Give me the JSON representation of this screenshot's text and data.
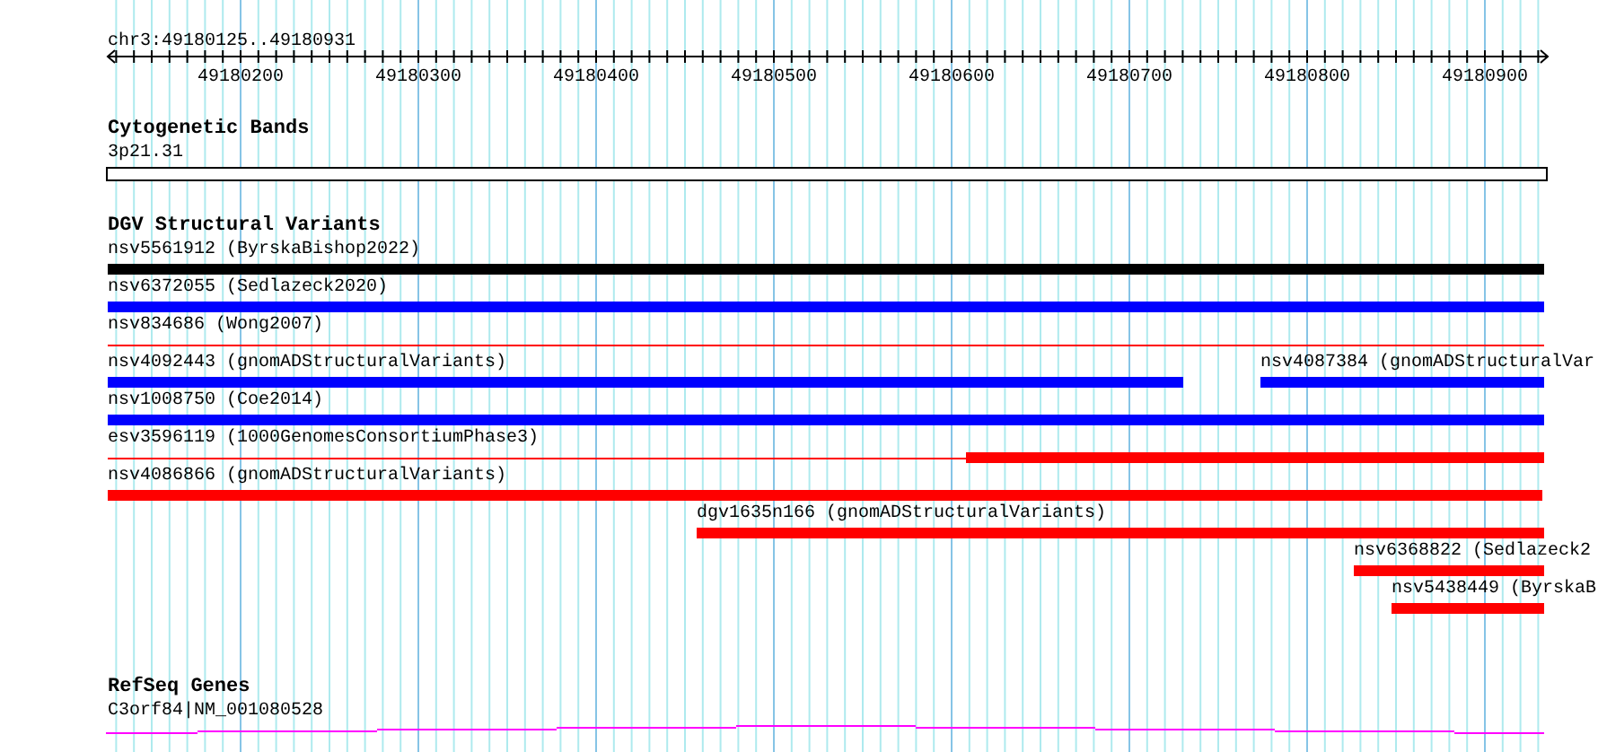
{
  "locus": "chr3:49180125..49180931",
  "ruler": {
    "ticks": [
      "49180200",
      "49180300",
      "49180400",
      "49180500",
      "49180600",
      "49180700",
      "49180800",
      "49180900"
    ]
  },
  "tracks": [
    {
      "kind": "cytoband",
      "title": "Cytogenetic Bands",
      "features": [
        {
          "label": "3p21.31"
        }
      ]
    },
    {
      "kind": "variants",
      "title": "DGV Structural Variants",
      "features": [
        {
          "label": "nsv5561912 (ByrskaBishop2022)",
          "color": "#000000",
          "kind": "bar"
        },
        {
          "label": "nsv6372055 (Sedlazeck2020)",
          "color": "#0000ff",
          "kind": "bar"
        },
        {
          "label": "nsv834686 (Wong2007)",
          "color": "#ff0000",
          "kind": "line"
        },
        {
          "label": "nsv4092443 (gnomADStructuralVariants)",
          "color": "#0000ff",
          "kind": "bar"
        },
        {
          "label": "nsv4087384 (gnomADStructuralVar",
          "color": "#0000ff",
          "kind": "bar"
        },
        {
          "label": "nsv1008750 (Coe2014)",
          "color": "#0000ff",
          "kind": "bar"
        },
        {
          "label": "esv3596119 (1000GenomesConsortiumPhase3)",
          "color": "#ff0000",
          "kind": "line-bar"
        },
        {
          "label": "nsv4086866 (gnomADStructuralVariants)",
          "color": "#ff0000",
          "kind": "bar"
        },
        {
          "label": "dgv1635n166 (gnomADStructuralVariants)",
          "color": "#ff0000",
          "kind": "bar"
        },
        {
          "label": "nsv6368822 (Sedlazeck2",
          "color": "#ff0000",
          "kind": "bar"
        },
        {
          "label": "nsv5438449 (ByrskaB",
          "color": "#ff0000",
          "kind": "bar"
        }
      ]
    },
    {
      "kind": "gene",
      "title": "RefSeq Genes",
      "features": [
        {
          "label": "C3orf84|NM_001080528",
          "color": "#ff00ff"
        }
      ]
    }
  ]
}
